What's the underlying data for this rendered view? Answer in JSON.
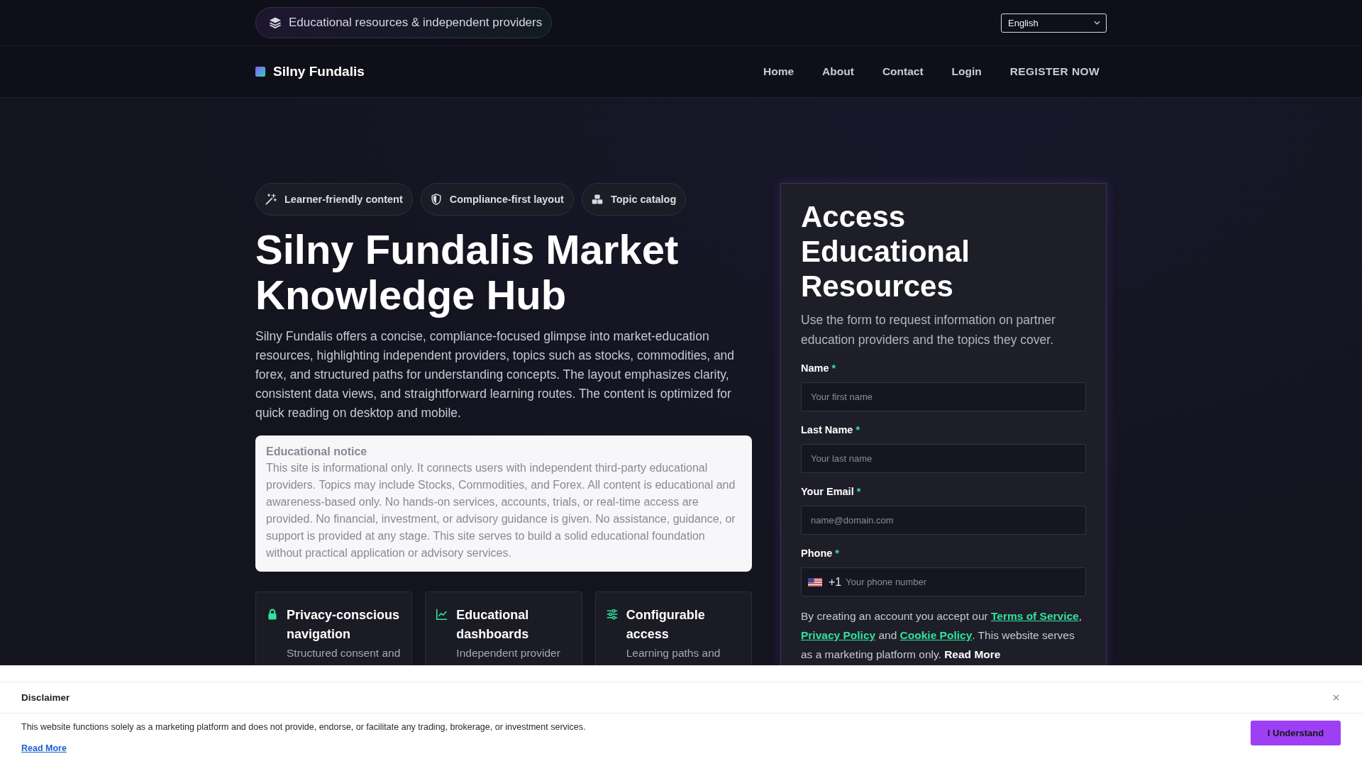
{
  "top_bar": {
    "tagline": "Educational resources & independent providers",
    "language_select": {
      "value": "English"
    }
  },
  "header": {
    "brand": "Silny Fundalis",
    "nav": [
      {
        "label": "Home"
      },
      {
        "label": "About"
      },
      {
        "label": "Contact"
      },
      {
        "label": "Login"
      },
      {
        "label": "REGISTER NOW"
      }
    ]
  },
  "hero": {
    "badges": [
      "Learner-friendly content",
      "Compliance-first layout",
      "Topic catalog"
    ],
    "title": "Silny Fundalis Market Knowledge Hub",
    "intro": "Silny Fundalis offers a concise, compliance-focused glimpse into market-education resources, highlighting independent providers, topics such as stocks, commodities, and forex, and structured paths for understanding concepts. The layout emphasizes clarity, consistent data views, and straightforward learning routes. The content is optimized for quick reading on desktop and mobile.",
    "notice": {
      "title": "Educational notice",
      "text": "This site is informational only. It connects users with independent third-party educational providers. Topics may include Stocks, Commodities, and Forex. All content is educational and awareness-based only. No hands-on services, accounts, trials, or real-time access are provided. No financial, investment, or advisory guidance is given. No assistance, guidance, or support is provided at any stage. This site serves to build a solid educational foundation without practical application or advisory services."
    },
    "features": [
      {
        "title": "Privacy-conscious navigation",
        "text": "Structured consent and"
      },
      {
        "title": "Educational dashboards",
        "text": "Independent provider"
      },
      {
        "title": "Configurable access",
        "text": "Learning paths and"
      }
    ]
  },
  "signup_form": {
    "title": "Access Educational Resources",
    "intro": "Use the form to request information on partner education providers and the topics they cover.",
    "fields": [
      {
        "kind": "text",
        "label": "Name",
        "required_mark": "*",
        "placeholder": "Your first name"
      },
      {
        "kind": "text",
        "label": "Last Name",
        "required_mark": "*",
        "placeholder": "Your last name"
      },
      {
        "kind": "text",
        "label": "Your Email",
        "required_mark": "*",
        "placeholder": "name@domain.com"
      },
      {
        "kind": "phone",
        "label": "Phone",
        "required_mark": "*",
        "dial_code": "+1",
        "placeholder": "Your phone number"
      }
    ],
    "consent": [
      {
        "kind": "text",
        "text": "By creating an account you accept our "
      },
      {
        "kind": "link",
        "text": "Terms of Service"
      },
      {
        "kind": "text",
        "text": ", "
      },
      {
        "kind": "link",
        "text": "Privacy Policy"
      },
      {
        "kind": "text",
        "text": " and "
      },
      {
        "kind": "link",
        "text": "Cookie Policy"
      },
      {
        "kind": "text",
        "text": ". This website serves as a marketing platform only. "
      },
      {
        "kind": "strong_link",
        "text": "Read More"
      }
    ]
  },
  "disclaimer": {
    "title": "Disclaimer",
    "text": "This website functions solely as a marketing platform and does not provide, endorse, or facilitate any trading, brokerage, or investment services.",
    "link": "Read More",
    "button": "I Understand"
  }
}
